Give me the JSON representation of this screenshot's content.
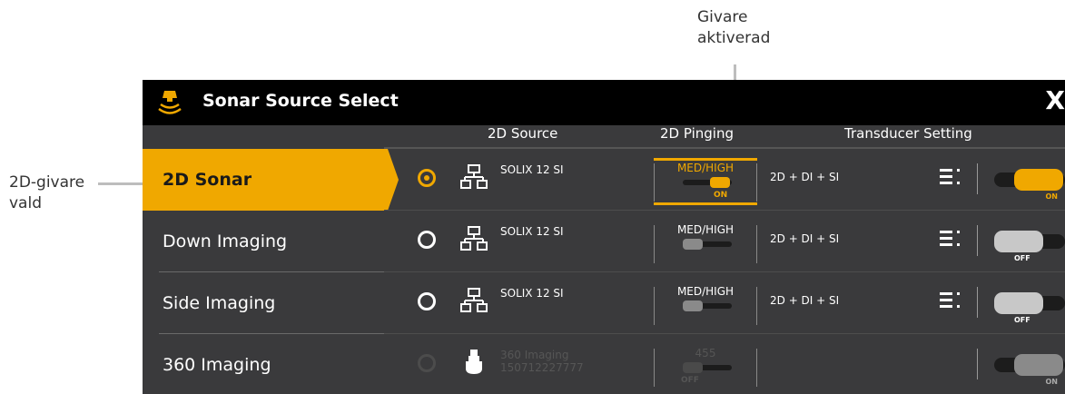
{
  "callouts": {
    "top": [
      "Givare",
      "aktiverad"
    ],
    "left": [
      "2D-givare",
      "vald"
    ]
  },
  "window": {
    "title": "Sonar Source Select",
    "close_glyph": "X"
  },
  "columns": {
    "source": "2D Source",
    "pinging": "2D Pinging",
    "transducer": "Transducer Setting"
  },
  "sidebar": {
    "items": [
      {
        "label": "2D Sonar",
        "active": true
      },
      {
        "label": "Down Imaging",
        "active": false
      },
      {
        "label": "Side Imaging",
        "active": false
      },
      {
        "label": "360 Imaging",
        "active": false
      }
    ]
  },
  "rows": [
    {
      "radio": "selected",
      "icon": "network-icon",
      "source": [
        "SOLIX 12 SI",
        ""
      ],
      "ping_mode": "MED/HIGH",
      "ping_state": "ON",
      "setting": "2D + DI + SI",
      "toggle": "ON"
    },
    {
      "radio": "unselected",
      "icon": "network-icon",
      "source": [
        "SOLIX 12 SI",
        ""
      ],
      "ping_mode": "MED/HIGH",
      "ping_state": "",
      "setting": "2D + DI + SI",
      "toggle": "OFF"
    },
    {
      "radio": "unselected",
      "icon": "network-icon",
      "source": [
        "SOLIX 12 SI",
        ""
      ],
      "ping_mode": "MED/HIGH",
      "ping_state": "",
      "setting": "2D + DI + SI",
      "toggle": "OFF"
    },
    {
      "radio": "disabled",
      "icon": "transducer-icon",
      "source": [
        "360 Imaging",
        "150712227777"
      ],
      "ping_mode": "455",
      "ping_state": "OFF",
      "setting": "",
      "toggle": "ON"
    }
  ],
  "colors": {
    "accent": "#f0a800",
    "panel": "#3a3a3c",
    "titlebar": "#000000"
  }
}
